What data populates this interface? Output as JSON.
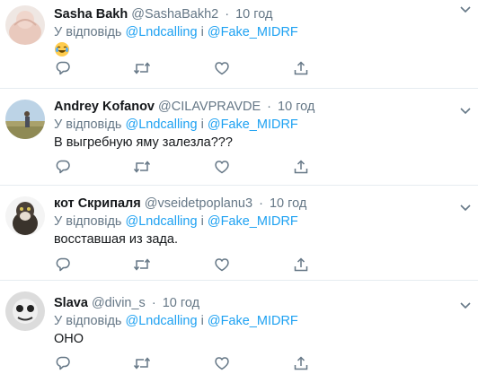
{
  "colors": {
    "link": "#1da1f2",
    "muted": "#657786",
    "text": "#14171a",
    "divider": "#e6ecf0"
  },
  "tweets": [
    {
      "name": "Sasha Bakh",
      "handle": "@SashaBakh2",
      "time": "10 год",
      "reply_prefix": "У відповідь",
      "mention1": "@Lndcalling",
      "conj": "і",
      "mention2": "@Fake_MIDRF",
      "text": "",
      "emoji": "face-with-tears-of-joy-emoji"
    },
    {
      "name": "Andrey Kofanov",
      "handle": "@CILAVPRAVDE",
      "time": "10 год",
      "reply_prefix": "У відповідь",
      "mention1": "@Lndcalling",
      "conj": "і",
      "mention2": "@Fake_MIDRF",
      "text": "В выгребную яму залезла???"
    },
    {
      "name": "кот Скрипаля",
      "handle": "@vseidetpoplanu3",
      "time": "10 год",
      "reply_prefix": "У відповідь",
      "mention1": "@Lndcalling",
      "conj": "і",
      "mention2": "@Fake_MIDRF",
      "text": "восставшая из зада."
    },
    {
      "name": "Slava",
      "handle": "@divin_s",
      "time": "10 год",
      "reply_prefix": "У відповідь",
      "mention1": "@Lndcalling",
      "conj": "і",
      "mention2": "@Fake_MIDRF",
      "text": "ОНО"
    }
  ],
  "action_icons": [
    "reply-icon",
    "retweet-icon",
    "like-icon",
    "share-icon"
  ]
}
